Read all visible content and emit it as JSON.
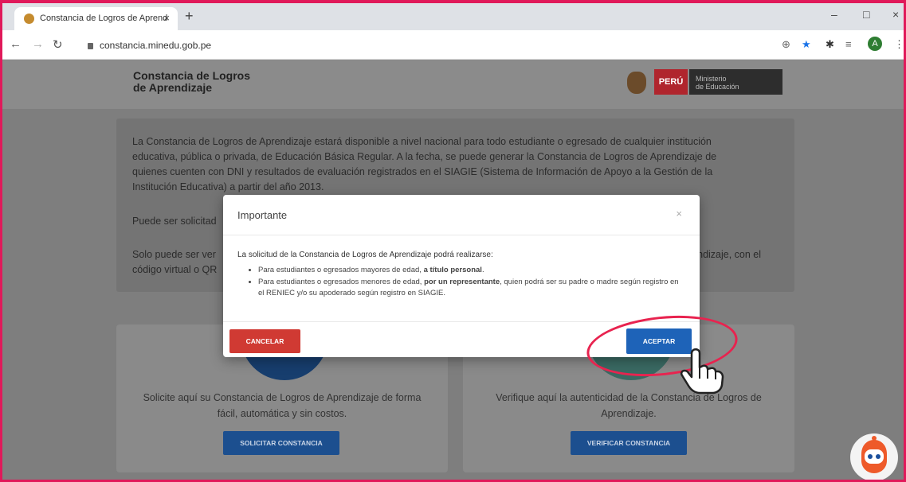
{
  "browser": {
    "tab_title": "Constancia de Logros de Aprend",
    "tab_close": "×",
    "new_tab": "+",
    "url": "constancia.minedu.gob.pe",
    "avatar_letter": "A",
    "window_controls": [
      "–",
      "□",
      "×"
    ]
  },
  "site": {
    "title": "Constancia de Logros\nde Aprendizaje",
    "peru_label": "PERÚ",
    "ministry_label": "Ministerio\nde Educación"
  },
  "info": {
    "paragraph1_lines": [
      "La Constancia de Logros de Aprendizaje estará disponible a nivel nacional para todo estudiante o egresado de cualquier institución",
      "educativa, pública o privada, de Educación Básica Regular. A la fecha, se puede generar la Constancia de Logros de Aprendizaje de",
      "quienes cuenten con DNI y resultados de evaluación registrados en el SIAGIE (Sistema de Información de Apoyo a la Gestión de la",
      "Institución Educativa) a partir del año 2013."
    ],
    "paragraph2_visible": "Puede ser solicitad",
    "paragraph3_visible_left": "Solo puede ser ver",
    "paragraph3_visible_right": "rendizaje, con el",
    "paragraph4_visible": "código virtual o QR"
  },
  "cards": [
    {
      "text": "Solicite aquí su Constancia de Logros de Aprendizaje de forma\nfácil, automática y sin costos.",
      "button": "SOLICITAR CONSTANCIA"
    },
    {
      "text": "Verifique aquí la autenticidad de la Constancia de Logros de\nAprendizaje.",
      "button": "VERIFICAR CONSTANCIA"
    }
  ],
  "modal": {
    "title": "Importante",
    "close": "×",
    "intro": "La solicitud de la Constancia de Logros de Aprendizaje podrá realizarse:",
    "item1_text": "Para estudiantes o egresados mayores de edad, ",
    "item1_bold": "a título personal",
    "item1_end": ".",
    "item2_text": "Para estudiantes o egresados menores de edad, ",
    "item2_bold": "por un representante",
    "item2_end": ", quien podrá ser su padre o madre según registro en el RENIEC y/o su apoderado según registro en SIAGIE.",
    "cancel": "CANCELAR",
    "accept": "ACEPTAR"
  },
  "colors": {
    "frame": "#e0195a",
    "cancel": "#d03a33",
    "accept": "#1e63b8",
    "highlight": "#e8234f"
  }
}
